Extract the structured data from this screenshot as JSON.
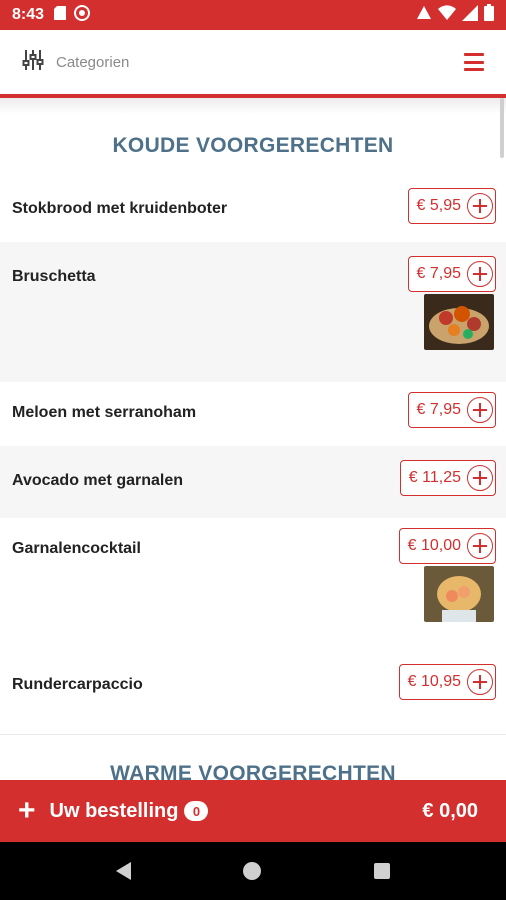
{
  "status_bar": {
    "time": "8:43"
  },
  "header": {
    "filter_label": "Categorien"
  },
  "sections": [
    {
      "title": "KOUDE VOORGERECHTEN",
      "items": [
        {
          "name": "Stokbrood met kruidenboter",
          "price": "€ 5,95",
          "has_image": false
        },
        {
          "name": "Bruschetta",
          "price": "€ 7,95",
          "has_image": true
        },
        {
          "name": "Meloen met serranoham",
          "price": "€ 7,95",
          "has_image": false
        },
        {
          "name": "Avocado met garnalen",
          "price": "€ 11,25",
          "has_image": false
        },
        {
          "name": "Garnalencocktail",
          "price": "€ 10,00",
          "has_image": true
        },
        {
          "name": "Rundercarpaccio",
          "price": "€ 10,95",
          "has_image": false
        }
      ]
    },
    {
      "title": "WARME VOORGERECHTEN",
      "items": []
    }
  ],
  "order_bar": {
    "label": "Uw bestelling",
    "count": "0",
    "total": "€ 0,00"
  },
  "colors": {
    "accent": "#d32f2f",
    "section_title": "#4e7189",
    "alt_row": "#f6f6f6"
  },
  "icons": [
    "sd-card-icon",
    "cast-icon",
    "wifi-icon",
    "signal-icon",
    "battery-icon",
    "filter-sliders-icon",
    "hamburger-menu-icon",
    "plus-circle-icon"
  ]
}
